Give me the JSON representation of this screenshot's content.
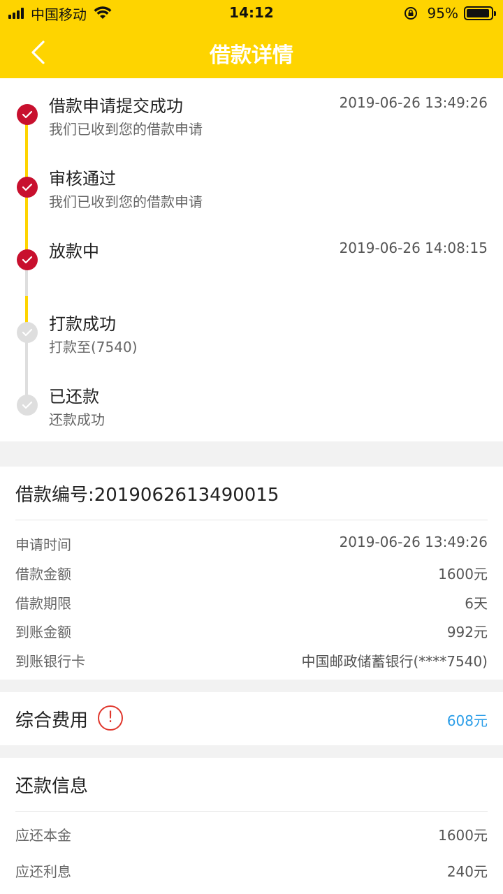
{
  "status_bar": {
    "carrier": "中国移动",
    "time": "14:12",
    "battery": "95%",
    "battery_level": 0.95
  },
  "nav": {
    "title": "借款详情"
  },
  "timeline": {
    "steps": [
      {
        "title": "借款申请提交成功",
        "subtitle": "我们已收到您的借款申请",
        "time": "2019-06-26 13:49:26",
        "status": "done"
      },
      {
        "title": "审核通过",
        "subtitle": "我们已收到您的借款申请",
        "time": "",
        "status": "done"
      },
      {
        "title": "放款中",
        "subtitle": "",
        "time": "2019-06-26 14:08:15",
        "status": "done"
      },
      {
        "title": "打款成功",
        "subtitle": "打款至(7540)",
        "time": "",
        "status": "pending"
      },
      {
        "title": "已还款",
        "subtitle": "还款成功",
        "time": "",
        "status": "pending"
      }
    ]
  },
  "loan": {
    "number_label": "借款编号:2019062613490015",
    "rows": [
      {
        "label": "申请时间",
        "value": "2019-06-26 13:49:26"
      },
      {
        "label": "借款金额",
        "value": "1600元"
      },
      {
        "label": "借款期限",
        "value": "6天"
      },
      {
        "label": "到账金额",
        "value": "992元"
      },
      {
        "label": "到账银行卡",
        "value": "中国邮政储蓄银行(****7540)"
      }
    ]
  },
  "fee": {
    "label": "综合费用",
    "icon": "!",
    "value": "608元"
  },
  "repayment": {
    "title": "还款信息",
    "rows": [
      {
        "label": "应还本金",
        "value": "1600元"
      },
      {
        "label": "应还利息",
        "value": "240元"
      }
    ]
  },
  "colors": {
    "brand_yellow": "#fed400",
    "done_red": "#c8102e",
    "pending_gray": "#dedede",
    "fee_blue": "#2a9de8"
  }
}
